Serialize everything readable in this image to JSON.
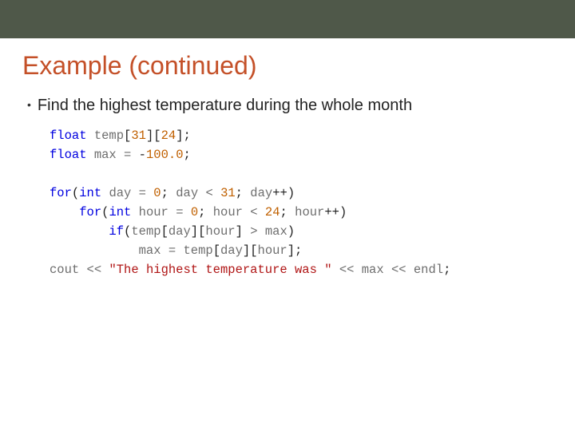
{
  "title": "Example (continued)",
  "bullet": "Find the highest temperature during the whole month",
  "code": {
    "kw_float1": "float",
    "temp": "temp",
    "lb1": "[",
    "n31": "31",
    "rb1": "]",
    "lb2": "[",
    "n24": "24",
    "rb2": "];",
    "kw_float2": "float",
    "max_decl": "max",
    "eq1": "=",
    "neg100": "-100.0",
    "semi1": ";",
    "kw_for1": "for",
    "lp1": "(",
    "kw_int1": "int",
    "day1": "day",
    "eq2": "=",
    "zero1": "0",
    "semi2": ";",
    "day2": "day",
    "lt1": "<",
    "n31b": "31",
    "semi3": ";",
    "day3": "day",
    "pp1": "++",
    "rp1": ")",
    "kw_for2": "for",
    "lp2": "(",
    "kw_int2": "int",
    "hour1": "hour",
    "eq3": "=",
    "zero2": "0",
    "semi4": ";",
    "hour2": "hour",
    "lt2": "<",
    "n24b": "24",
    "semi5": ";",
    "hour3": "hour",
    "pp2": "++",
    "rp2": ")",
    "kw_if": "if",
    "lp3": "(",
    "temp2": "temp",
    "lb3": "[",
    "day4": "day",
    "rb3": "]",
    "lb4": "[",
    "hour4": "hour",
    "rb4": "]",
    "gt1": ">",
    "max1": "max",
    "rp3": ")",
    "max2": "max",
    "eq4": "=",
    "temp3": "temp",
    "lb5": "[",
    "day5": "day",
    "rb5": "]",
    "lb6": "[",
    "hour5": "hour",
    "rb6": "];",
    "cout": "cout",
    "ins1": "<<",
    "strmsg": "\"The highest temperature was \"",
    "ins2": "<<",
    "max3": "max",
    "ins3": "<<",
    "endl": "endl",
    "semi6": ";"
  }
}
